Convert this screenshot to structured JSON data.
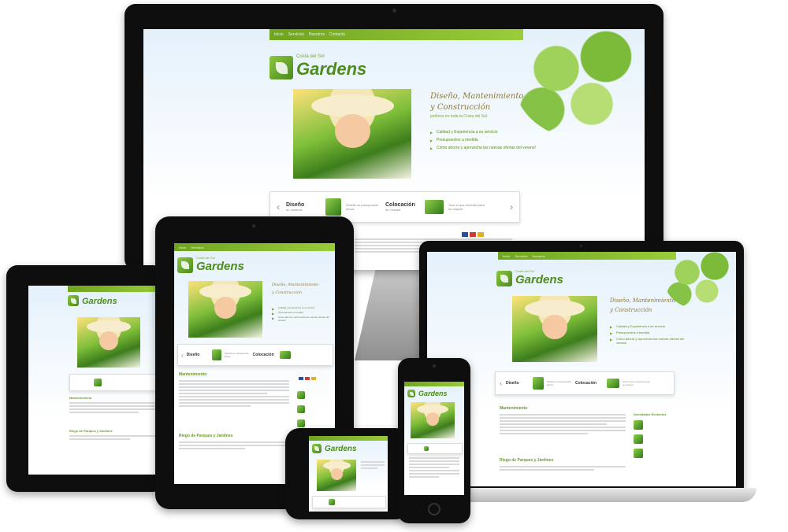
{
  "site": {
    "logo_small": "Costa del Sol",
    "logo_title": "Gardens",
    "nav_items": [
      "Inicio",
      "Servicios",
      "Nosotros",
      "Contacto"
    ],
    "tagline_line1": "Diseño, Mantenimiento",
    "tagline_line2": "y Construcción",
    "tagline_sub": "jardines en toda la Costa del Sol",
    "bullets": [
      "Calidad y Experiencia a su servicio",
      "Presupuestos a medida",
      "Cómo ahorra y aprovecha las nuevas ofertas del verano!"
    ],
    "slides": [
      {
        "title": "Diseño",
        "subtitle": "de Jardines",
        "desc": "Solicite su presupuesto ahora"
      },
      {
        "title": "Colocación",
        "subtitle": "de Césped",
        "desc": "Todo lo que necesita para su césped"
      }
    ],
    "sections": {
      "mantenimiento": "Mantenimiento",
      "riego": "Riego de Parques y Jardines",
      "novedades": "Novedades Recientes"
    },
    "prev_arrow": "‹",
    "next_arrow": "›"
  },
  "colors": {
    "brand_green": "#6fa51f",
    "logo_green": "#4c8d1a",
    "device_black": "#0e0e0e"
  }
}
